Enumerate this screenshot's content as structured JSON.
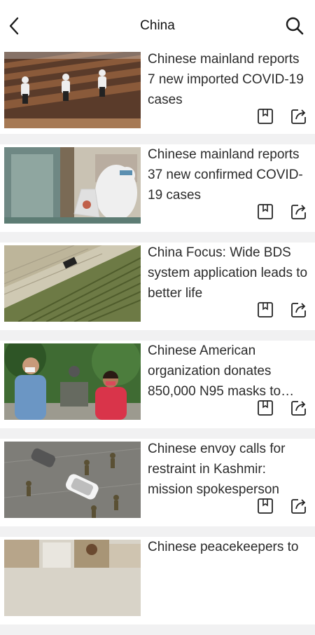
{
  "header": {
    "title": "China",
    "back_icon": "chevron-left-icon",
    "search_icon": "search-icon"
  },
  "articles": [
    {
      "headline": "Chinese mainland reports 7 new imported COVID-19 cases",
      "image": "theater-seats-disinfection"
    },
    {
      "headline": "Chinese mainland reports 37 new confirmed COVID-19 cases",
      "image": "health-worker-ppe"
    },
    {
      "headline": "China Focus: Wide BDS system application leads to better life",
      "image": "aerial-field-tractor"
    },
    {
      "headline": "Chinese American organization donates 850,000 N95 masks to…",
      "image": "people-wearing-masks-fountain"
    },
    {
      "headline": "Chinese envoy calls for restraint in Kashmir: mission spokesperson",
      "image": "aerial-soldiers-cars"
    },
    {
      "headline": "Chinese peacekeepers to",
      "image": "boxes-warehouse"
    }
  ],
  "actions": {
    "bookmark_icon": "bookmark-icon",
    "share_icon": "share-icon"
  },
  "colors": {
    "separator": "#f1f1f2",
    "text": "#2b2b2b",
    "icon": "#222222"
  }
}
